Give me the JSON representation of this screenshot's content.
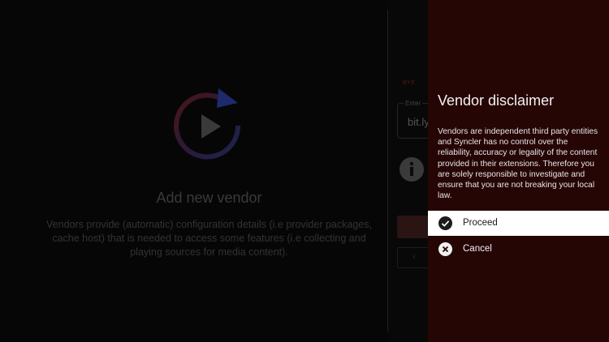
{
  "left_panel": {
    "title": "Add new vendor",
    "description": "Vendors provide (automatic) configuration details (i.e provider packages, cache host) that is needed to access some features (i.e collecting and playing sources for media content)."
  },
  "form": {
    "section_label": "BYE",
    "field_label": "Enter",
    "field_value": "bit.ly"
  },
  "dialog": {
    "title": "Vendor disclaimer",
    "body": "Vendors are independent third party entities and Syncler has no control over the reliability, accuracy or legality of the content provided in their extensions. Therefore you are solely responsible to investigate and ensure that you are not breaking your local law.",
    "options": [
      {
        "label": "Proceed",
        "icon": "check-circle-icon",
        "selected": true
      },
      {
        "label": "Cancel",
        "icon": "close-circle-icon",
        "selected": false
      }
    ]
  },
  "colors": {
    "accent_red": "#b3262b",
    "accent_blue": "#2b3a9e",
    "dialog_bg": "#260505"
  }
}
